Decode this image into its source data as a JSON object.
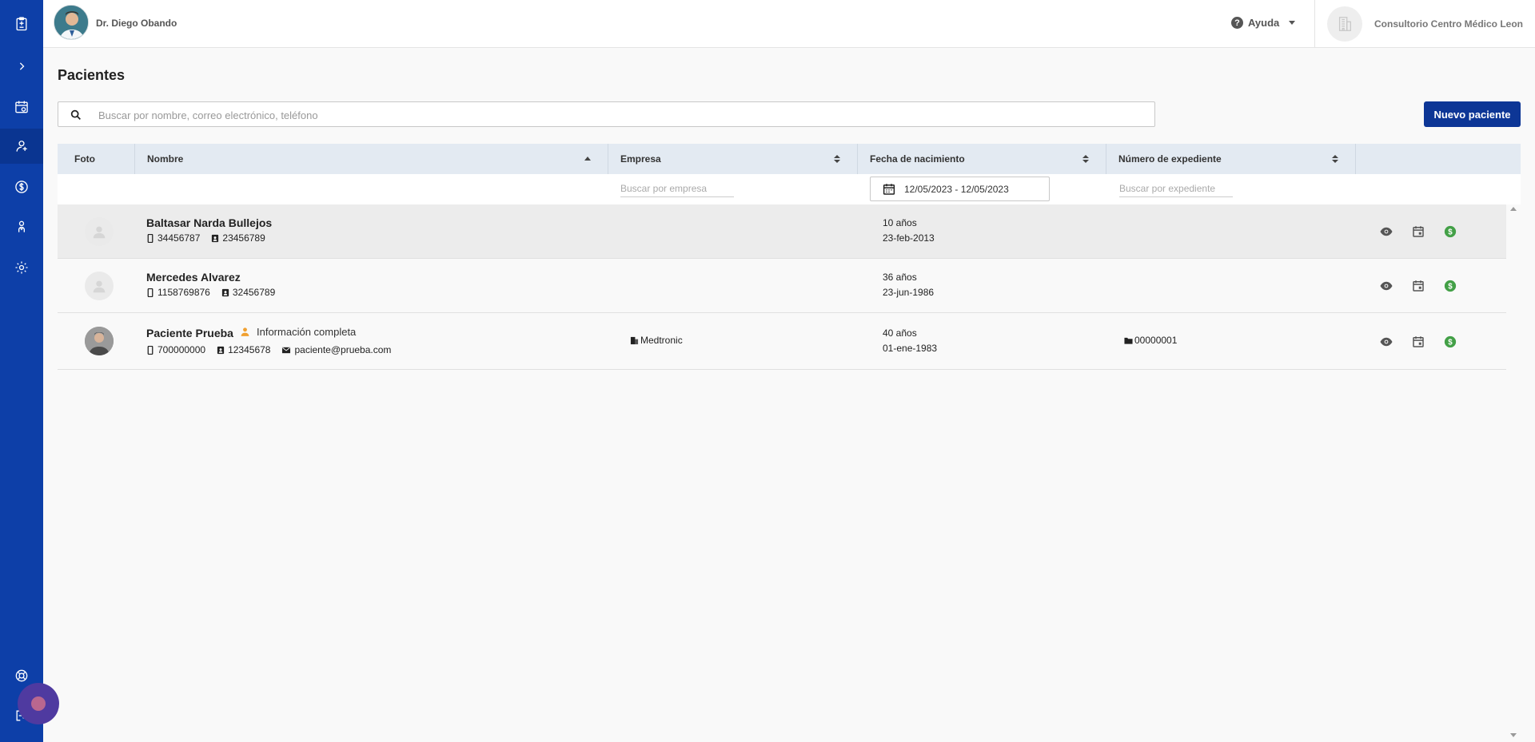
{
  "user": {
    "name": "Dr. Diego Obando"
  },
  "header": {
    "help_label": "Ayuda",
    "clinic_name": "Consultorio Centro Médico Leon"
  },
  "page": {
    "title": "Pacientes",
    "search_placeholder": "Buscar por nombre, correo electrónico, teléfono",
    "new_patient_label": "Nuevo paciente"
  },
  "table": {
    "columns": {
      "photo": "Foto",
      "name": "Nombre",
      "company": "Empresa",
      "birth": "Fecha de nacimiento",
      "record": "Número de expediente"
    },
    "filters": {
      "company_placeholder": "Buscar por empresa",
      "date_range": "12/05/2023 - 12/05/2023",
      "record_placeholder": "Buscar por expediente"
    },
    "rows": [
      {
        "name": "Baltasar Narda Bullejos",
        "phone": "34456787",
        "id": "23456789",
        "company": "",
        "age": "10 años",
        "birth": "23-feb-2013",
        "record": ""
      },
      {
        "name": "Mercedes Alvarez",
        "phone": "1158769876",
        "id": "32456789",
        "company": "",
        "age": "36 años",
        "birth": "23-jun-1986",
        "record": ""
      },
      {
        "name": "Paciente Prueba",
        "tag": "Información completa",
        "phone": "700000000",
        "id": "12345678",
        "email": "paciente@prueba.com",
        "company": "Medtronic",
        "age": "40 años",
        "birth": "01-ene-1983",
        "record": "00000001"
      }
    ]
  },
  "colors": {
    "sidebar": "#0d3fa8",
    "primary_button": "#0d3696",
    "header_row": "#e3eaf2",
    "money_icon": "#43a047",
    "tag_icon": "#f0a030"
  }
}
